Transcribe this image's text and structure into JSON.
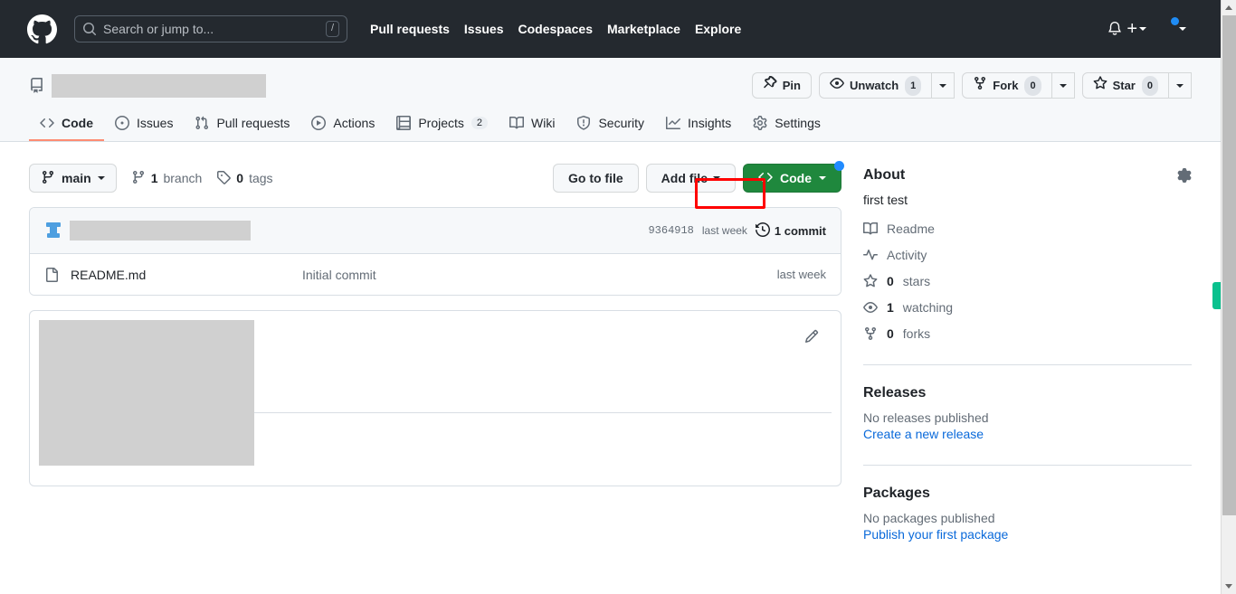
{
  "header": {
    "logo_icon": "github-mark-icon",
    "search": {
      "placeholder": "Search or jump to...",
      "shortcut_key": "/",
      "icon": "search-icon"
    },
    "nav": [
      {
        "label": "Pull requests"
      },
      {
        "label": "Issues"
      },
      {
        "label": "Codespaces"
      },
      {
        "label": "Marketplace"
      },
      {
        "label": "Explore"
      }
    ],
    "notifications_icon": "bell-icon",
    "create_new_icon": "plus-icon",
    "account_icon": "avatar-icon",
    "bg_color": "#24292f"
  },
  "repo": {
    "owner_repo_redacted": true,
    "repo_icon": "repo-icon",
    "actions": {
      "pin": {
        "label": "Pin",
        "icon": "pin-icon"
      },
      "watch": {
        "label": "Unwatch",
        "count": "1",
        "icon": "eye-icon"
      },
      "fork": {
        "label": "Fork",
        "count": "0",
        "icon": "fork-icon"
      },
      "star": {
        "label": "Star",
        "count": "0",
        "icon": "star-icon"
      }
    },
    "tabs": [
      {
        "label": "Code",
        "icon": "code-icon",
        "count": "",
        "active": true
      },
      {
        "label": "Issues",
        "icon": "issue-opened-icon",
        "count": "",
        "active": false
      },
      {
        "label": "Pull requests",
        "icon": "git-pull-request-icon",
        "count": "",
        "active": false
      },
      {
        "label": "Actions",
        "icon": "play-icon",
        "count": "",
        "active": false
      },
      {
        "label": "Projects",
        "icon": "table-icon",
        "count": "2",
        "active": false
      },
      {
        "label": "Wiki",
        "icon": "book-icon",
        "count": "",
        "active": false
      },
      {
        "label": "Security",
        "icon": "shield-icon",
        "count": "",
        "active": false
      },
      {
        "label": "Insights",
        "icon": "graph-icon",
        "count": "",
        "active": false
      },
      {
        "label": "Settings",
        "icon": "gear-icon",
        "count": "",
        "active": false
      }
    ]
  },
  "file_nav": {
    "branch": {
      "label": "main",
      "icon": "git-branch-icon"
    },
    "branches": {
      "count": "1",
      "label": "branch",
      "icon": "git-branch-icon"
    },
    "tags": {
      "count": "0",
      "label": "tags",
      "icon": "tag-icon"
    },
    "go_to_file": "Go to file",
    "add_file": "Add file",
    "code_button": "Code",
    "code_icon": "code-icon"
  },
  "commit_bar": {
    "author_redacted": true,
    "author_avatar_icon": "avatar-icon",
    "sha": "9364918",
    "time": "last week",
    "commit_count": "1 commit",
    "history_icon": "history-icon"
  },
  "files": [
    {
      "name": "README.md",
      "message": "Initial commit",
      "time": "last week",
      "icon": "file-icon"
    }
  ],
  "readme": {
    "content_redacted": true,
    "edit_icon": "pencil-icon"
  },
  "sidebar": {
    "about": {
      "title": "About",
      "settings_icon": "gear-icon",
      "description": "first test",
      "links": [
        {
          "label": "Readme",
          "icon": "book-icon",
          "prefix": ""
        },
        {
          "label": "Activity",
          "icon": "pulse-icon",
          "prefix": ""
        },
        {
          "label": "stars",
          "icon": "star-icon",
          "prefix": "0"
        },
        {
          "label": "watching",
          "icon": "eye-icon",
          "prefix": "1"
        },
        {
          "label": "forks",
          "icon": "fork-icon",
          "prefix": "0"
        }
      ]
    },
    "releases": {
      "title": "Releases",
      "empty_text": "No releases published",
      "action_link": "Create a new release"
    },
    "packages": {
      "title": "Packages",
      "empty_text": "No packages published",
      "action_link": "Publish your first package"
    }
  },
  "annotations": {
    "highlight_color": "#ff0000",
    "highlight_target": "Add file",
    "accent_green": "#1f883d",
    "accent_blue": "#0969da",
    "side_tab_color": "#0ac18e"
  }
}
